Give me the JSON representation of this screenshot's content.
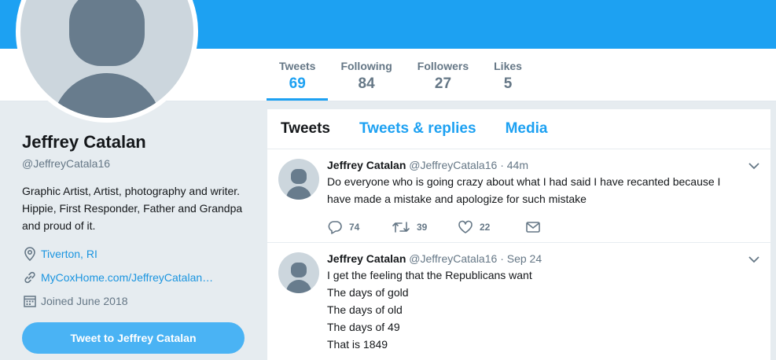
{
  "profile": {
    "name": "Jeffrey Catalan",
    "handle": "@JeffreyCatala16",
    "bio": "Graphic Artist, Artist, photography and writer. Hippie, First Responder, Father and Grandpa and proud of it.",
    "location": "Tiverton, RI",
    "website": "MyCoxHome.com/JeffreyCatalan…",
    "joined": "Joined June 2018",
    "tweet_to_label": "Tweet to Jeffrey Catalan"
  },
  "stats": [
    {
      "label": "Tweets",
      "value": "69"
    },
    {
      "label": "Following",
      "value": "84"
    },
    {
      "label": "Followers",
      "value": "27"
    },
    {
      "label": "Likes",
      "value": "5"
    }
  ],
  "tabs": [
    {
      "label": "Tweets"
    },
    {
      "label": "Tweets & replies"
    },
    {
      "label": "Media"
    }
  ],
  "tweets": [
    {
      "name": "Jeffrey Catalan",
      "handle": "@JeffreyCatala16",
      "sep": "·",
      "time": "44m",
      "lines": [
        "Do everyone who is going crazy about what I had said I have recanted because I have made a mistake and apologize for such mistake"
      ],
      "replies": "74",
      "retweets": "39",
      "likes": "22"
    },
    {
      "name": "Jeffrey Catalan",
      "handle": "@JeffreyCatala16",
      "sep": "·",
      "time": "Sep 24",
      "lines": [
        "I get the feeling that the Republicans want",
        "The days of gold",
        "The days of old",
        "The days of 49",
        "That is 1849"
      ]
    }
  ],
  "colors": {
    "brand": "#1da1f2",
    "button": "#4ab3f4",
    "muted": "#657786",
    "text": "#14171a",
    "background": "#e6ecf0"
  },
  "icons": [
    "location-pin-icon",
    "link-icon",
    "calendar-icon",
    "reply-icon",
    "retweet-icon",
    "heart-icon",
    "direct-message-icon",
    "chevron-down-icon"
  ]
}
